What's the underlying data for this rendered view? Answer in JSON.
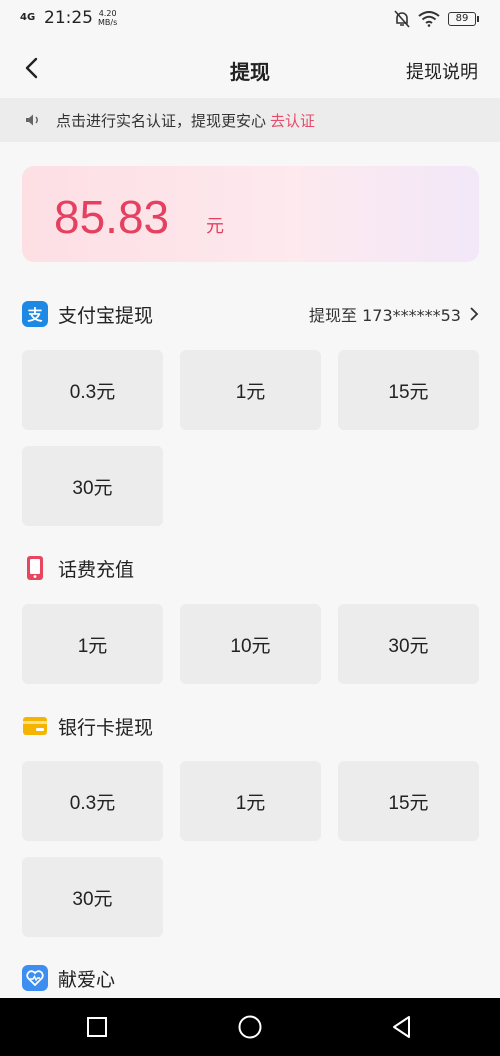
{
  "status": {
    "network": "4G",
    "time": "21:25",
    "speed_value": "4.20",
    "speed_unit": "MB/s",
    "battery": "89"
  },
  "nav": {
    "title": "提现",
    "right_label": "提现说明"
  },
  "notice": {
    "text": "点击进行实名认证，提现更安心",
    "link": "去认证"
  },
  "balance": {
    "amount": "85.83",
    "unit": "元"
  },
  "alipay": {
    "title": "支付宝提现",
    "icon_char": "支",
    "target": "提现至 173******53",
    "options": [
      "0.3元",
      "1元",
      "15元",
      "30元"
    ]
  },
  "phone": {
    "title": "话费充值",
    "options": [
      "1元",
      "10元",
      "30元"
    ]
  },
  "bank": {
    "title": "银行卡提现",
    "options": [
      "0.3元",
      "1元",
      "15元",
      "30元"
    ]
  },
  "charity": {
    "title": "献爱心"
  },
  "colors": {
    "accent": "#e84a6b",
    "alipay": "#1e88e5",
    "phone": "#e8455f",
    "bank": "#f5b400",
    "charity": "#3d8ef0"
  }
}
